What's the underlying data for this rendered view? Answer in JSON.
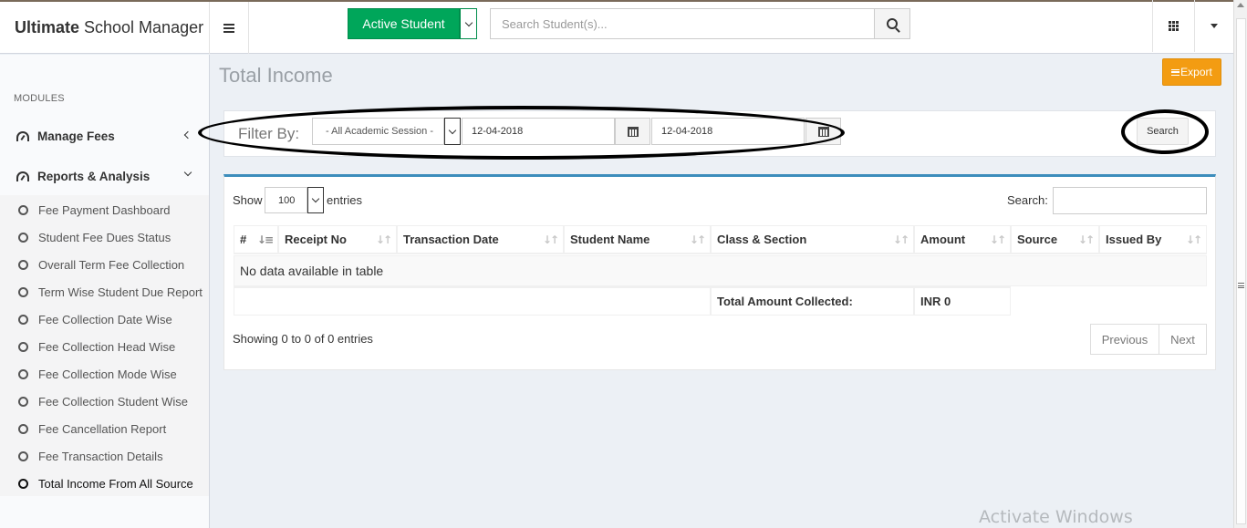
{
  "app": {
    "title_bold": "Ultimate",
    "title_rest": "School Manager"
  },
  "topbar": {
    "student_status": "Active Student",
    "search_placeholder": "Search Student(s)..."
  },
  "sidebar": {
    "section_label": "MODULES",
    "groups": [
      {
        "label": "Manage Fees",
        "expanded": false
      },
      {
        "label": "Reports & Analysis",
        "expanded": true
      }
    ],
    "items": [
      {
        "label": "Fee Payment Dashboard"
      },
      {
        "label": "Student Fee Dues Status"
      },
      {
        "label": "Overall Term Fee Collection"
      },
      {
        "label": "Term Wise Student Due Report"
      },
      {
        "label": "Fee Collection Date Wise"
      },
      {
        "label": "Fee Collection Head Wise"
      },
      {
        "label": "Fee Collection Mode Wise"
      },
      {
        "label": "Fee Collection Student Wise"
      },
      {
        "label": "Fee Cancellation Report"
      },
      {
        "label": "Fee Transaction Details"
      },
      {
        "label": "Total Income From All Source",
        "active": true
      }
    ]
  },
  "page": {
    "title": "Total Income",
    "export_label": "Export"
  },
  "filter": {
    "label": "Filter By:",
    "session": "- All Academic Session -",
    "from_date": "12-04-2018",
    "to_date": "12-04-2018",
    "search_label": "Search"
  },
  "table": {
    "show_label": "Show",
    "page_length": "100",
    "entries_label": "entries",
    "search_label": "Search:",
    "columns": [
      "#",
      "Receipt No",
      "Transaction Date",
      "Student Name",
      "Class & Section",
      "Amount",
      "Source",
      "Issued By"
    ],
    "empty_message": "No data available in table",
    "total_label": "Total Amount Collected:",
    "total_value": "INR 0",
    "info": "Showing 0 to 0 of 0 entries",
    "prev_label": "Previous",
    "next_label": "Next"
  },
  "os_watermark": "Activate Windows",
  "colors": {
    "success": "#00a65a",
    "warning": "#f39c12",
    "primary_border": "#3c8dbc",
    "content_bg": "#ecf0f5"
  }
}
